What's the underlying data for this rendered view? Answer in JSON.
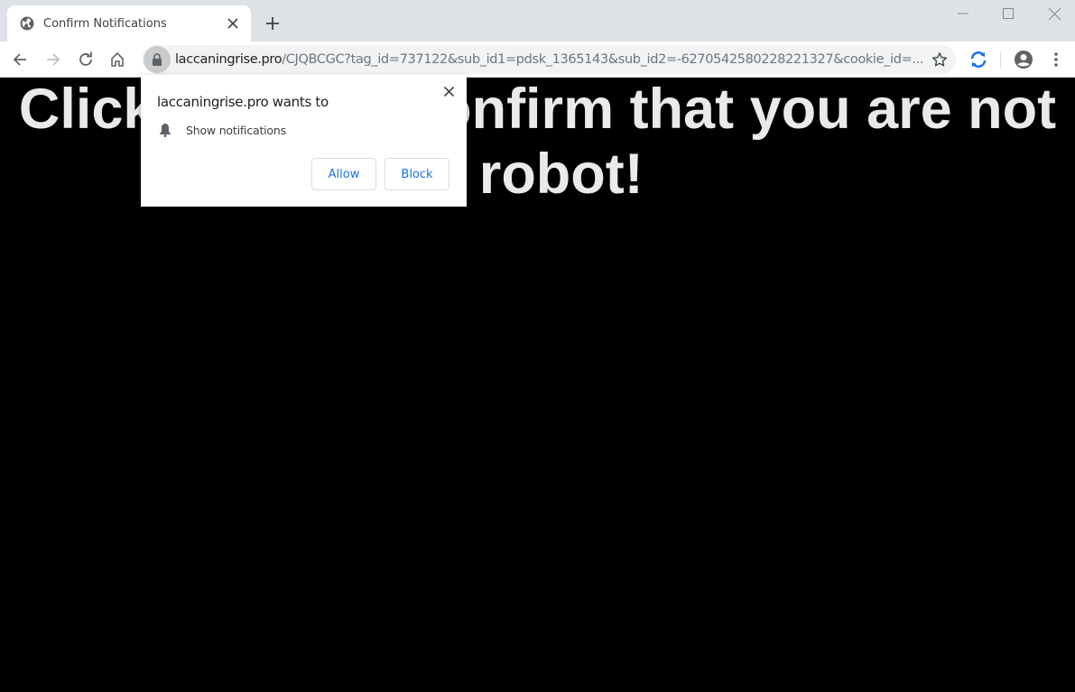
{
  "browser": {
    "tab": {
      "title": "Confirm Notifications",
      "favicon": "globe-icon"
    },
    "new_tab_symbol": "+",
    "window_controls": {
      "minimize": "minimize-icon",
      "maximize": "maximize-icon",
      "close": "close-icon"
    },
    "address_bar": {
      "host": "laccaningrise.pro",
      "path": "/CJQBCGC?tag_id=737122&sub_id1=pdsk_1365143&sub_id2=-6270542580228221327&cookie_id=..."
    },
    "extension_color": "#1a73e8"
  },
  "page": {
    "headline": "Click Allow to confirm that you are not a robot!"
  },
  "permission_popup": {
    "title": "laccaningrise.pro wants to",
    "permission": "Show notifications",
    "allow_label": "Allow",
    "block_label": "Block",
    "close_symbol": "✕"
  }
}
